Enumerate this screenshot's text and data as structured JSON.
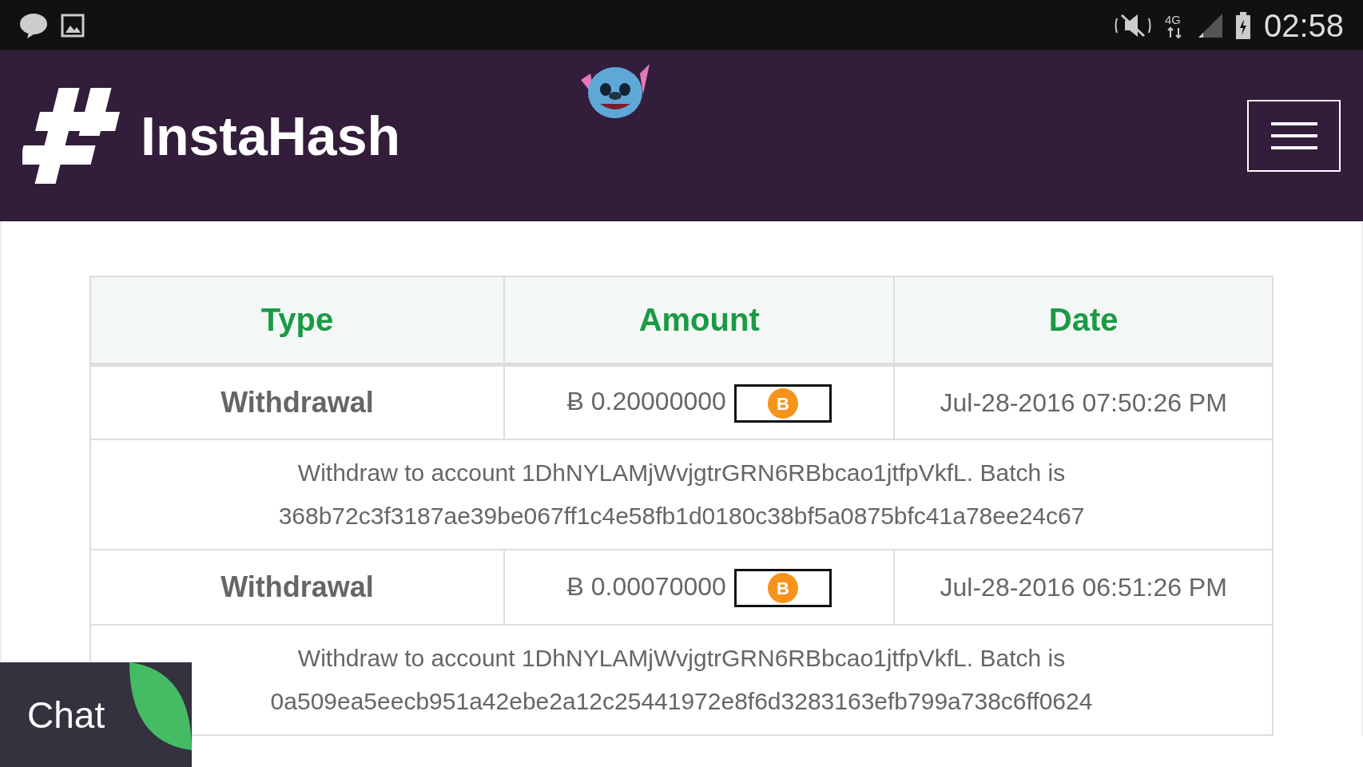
{
  "status_bar": {
    "network": "4G",
    "time": "02:58"
  },
  "header": {
    "logo_text": "InstaHash"
  },
  "table": {
    "columns": [
      "Type",
      "Amount",
      "Date"
    ],
    "rows": [
      {
        "type": "Withdrawal",
        "currency_symbol": "Ƀ",
        "amount": "0.20000000",
        "coin_glyph": "B",
        "date": "Jul-28-2016 07:50:26 PM",
        "description": "Withdraw to account 1DhNYLAMjWvjgtrGRN6RBbcao1jtfpVkfL. Batch is 368b72c3f3187ae39be067ff1c4e58fb1d0180c38bf5a0875bfc41a78ee24c67"
      },
      {
        "type": "Withdrawal",
        "currency_symbol": "Ƀ",
        "amount": "0.00070000",
        "coin_glyph": "B",
        "date": "Jul-28-2016 06:51:26 PM",
        "description": "Withdraw to account 1DhNYLAMjWvjgtrGRN6RBbcao1jtfpVkfL. Batch is 0a509ea5eecb951a42ebe2a12c25441972e8f6d3283163efb799a738c6ff0624"
      }
    ]
  },
  "chat": {
    "label": "Chat"
  }
}
